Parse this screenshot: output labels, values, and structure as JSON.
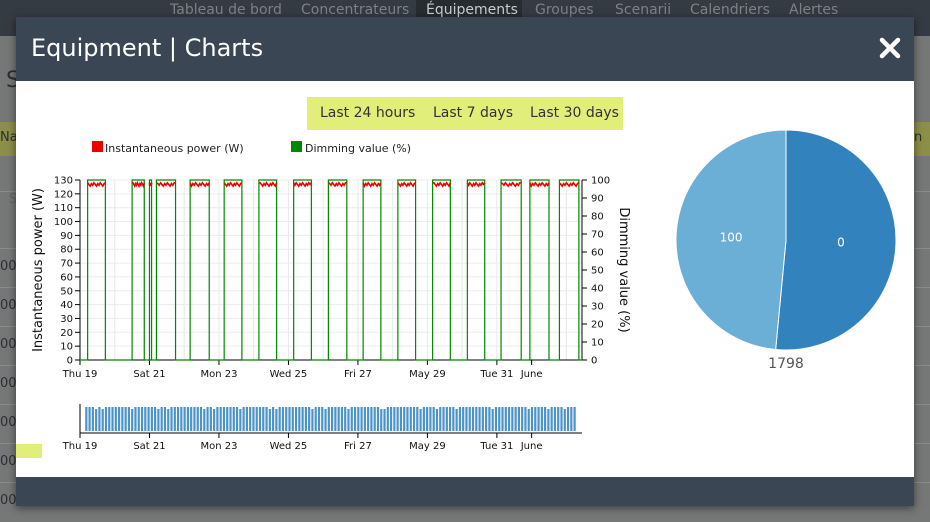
{
  "nav": {
    "items": [
      "Tableau de bord",
      "Concentrateurs",
      "Équipements",
      "Groupes",
      "Scenarii",
      "Calendriers",
      "Alertes"
    ],
    "active_index": 2
  },
  "background": {
    "fragments": [
      "S",
      "Na",
      "n",
      "S",
      "00",
      "00",
      "00",
      "00",
      "00",
      "00",
      "00"
    ]
  },
  "modal": {
    "title": "Equipment | Charts",
    "close_icon": "close-x-icon"
  },
  "range_buttons": [
    "Last 24 hours",
    "Last 7 days",
    "Last 30 days"
  ],
  "colors": {
    "power": "#ee0000",
    "dimming": "#008800",
    "navigator": "#4c93c9",
    "pie_a": "#3182bd",
    "pie_b": "#6baed6",
    "header": "#3a4654",
    "range_bar": "#e2ee7a"
  },
  "chart_data": {
    "type": "line",
    "legend": [
      "Instantaneous power (W)",
      "Dimming value (%)"
    ],
    "y_left_label": "Instantaneous power (W)",
    "y_right_label": "Dimming value (%)",
    "y_left_ticks": [
      0,
      10,
      20,
      30,
      40,
      50,
      60,
      70,
      80,
      90,
      100,
      110,
      120,
      130
    ],
    "y_right_ticks": [
      0,
      10,
      20,
      30,
      40,
      50,
      60,
      70,
      80,
      90,
      100
    ],
    "ylim_left": [
      0,
      130
    ],
    "ylim_right": [
      0,
      100
    ],
    "x_tick_labels": [
      "Thu 19",
      "Sat 21",
      "Mon 23",
      "Wed 25",
      "Fri 27",
      "May 29",
      "Tue 31",
      "June"
    ],
    "x_ticks_day": [
      0,
      2,
      4,
      6,
      8,
      10,
      12,
      13
    ],
    "x_range_days": [
      0,
      14.45
    ],
    "on_intervals_days": [
      [
        0.22,
        0.73
      ],
      [
        1.5,
        1.85
      ],
      [
        2.0,
        2.06
      ],
      [
        2.2,
        2.75
      ],
      [
        3.17,
        3.72
      ],
      [
        4.15,
        4.66
      ],
      [
        5.15,
        5.66
      ],
      [
        6.15,
        6.66
      ],
      [
        7.15,
        7.68
      ],
      [
        8.15,
        8.66
      ],
      [
        9.15,
        9.66
      ],
      [
        10.15,
        10.66
      ],
      [
        11.15,
        11.65
      ],
      [
        12.12,
        12.7
      ],
      [
        12.95,
        13.5
      ],
      [
        13.8,
        14.36
      ]
    ],
    "on_power_w": 128,
    "on_dimming_pct": 100,
    "navigator_x_tick_labels": [
      "Thu 19",
      "Sat 21",
      "Mon 23",
      "Wed 25",
      "Fri 27",
      "May 29",
      "Tue 31",
      "June"
    ]
  },
  "pie": {
    "type": "pie",
    "slices": [
      {
        "label": "0",
        "value": 51.5
      },
      {
        "label": "100",
        "value": 48.5
      }
    ],
    "total_label": "1798"
  }
}
